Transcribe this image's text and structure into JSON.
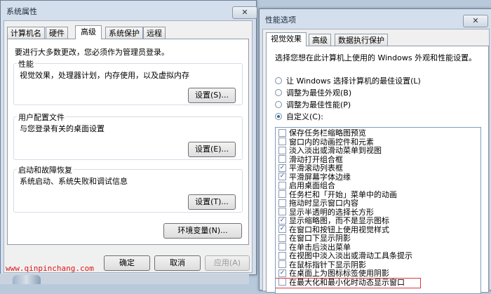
{
  "left_window": {
    "title": "系统属性",
    "close_label": "✕",
    "tabs": [
      "计算机名",
      "硬件",
      "高级",
      "系统保护",
      "远程"
    ],
    "active_tab": "高级",
    "admin_note": "要进行大多数更改，您必须作为管理员登录。",
    "groups": {
      "performance": {
        "title": "性能",
        "desc": "视觉效果，处理器计划，内存使用，以及虚拟内存",
        "button": "设置(S)..."
      },
      "user_profiles": {
        "title": "用户配置文件",
        "desc": "与您登录有关的桌面设置",
        "button": "设置(E)..."
      },
      "startup": {
        "title": "启动和故障恢复",
        "desc": "系统启动、系统失败和调试信息",
        "button": "设置(T)..."
      }
    },
    "env_button": "环境变量(N)...",
    "ok": "确定",
    "cancel": "取消",
    "apply": "应用(A)"
  },
  "right_window": {
    "title": "性能选项",
    "close_label": "✕",
    "tabs": [
      "视觉效果",
      "高级",
      "数据执行保护"
    ],
    "active_tab": "视觉效果",
    "intro": "选择您想在此计算机上使用的 Windows 外观和性能设置。",
    "radios": [
      {
        "label": "让 Windows 选择计算机的最佳设置(L)",
        "checked": false
      },
      {
        "label": "调整为最佳外观(B)",
        "checked": false
      },
      {
        "label": "调整为最佳性能(P)",
        "checked": false
      },
      {
        "label": "自定义(C):",
        "checked": true
      }
    ],
    "effects": [
      {
        "label": "保存任务栏缩略图预览",
        "checked": false
      },
      {
        "label": "窗口内的动画控件和元素",
        "checked": false
      },
      {
        "label": "淡入淡出或滑动菜单到视图",
        "checked": false
      },
      {
        "label": "滑动打开组合框",
        "checked": false
      },
      {
        "label": "平滑滚动列表框",
        "checked": true
      },
      {
        "label": "平滑屏幕字体边缘",
        "checked": true
      },
      {
        "label": "启用桌面组合",
        "checked": false
      },
      {
        "label": "任务栏和「开始」菜单中的动画",
        "checked": false
      },
      {
        "label": "拖动时显示窗口内容",
        "checked": false
      },
      {
        "label": "显示半透明的选择长方形",
        "checked": false
      },
      {
        "label": "显示缩略图，而不是显示图标",
        "checked": true
      },
      {
        "label": "在窗口和按钮上使用视觉样式",
        "checked": true
      },
      {
        "label": "在窗口下显示阴影",
        "checked": false
      },
      {
        "label": "在单击后淡出菜单",
        "checked": false
      },
      {
        "label": "在视图中淡入淡出或滑动工具条提示",
        "checked": false
      },
      {
        "label": "在鼠标指针下显示阴影",
        "checked": false
      },
      {
        "label": "在桌面上为图标标签使用阴影",
        "checked": true
      },
      {
        "label": "在最大化和最小化时动态显示窗口",
        "checked": false
      }
    ],
    "highlighted_effect_index": 17
  },
  "watermark": "www.qinpinchang.com",
  "colors": {
    "highlight": "#e0343f",
    "watermark": "#e01515",
    "frame": "#d4dfed"
  }
}
